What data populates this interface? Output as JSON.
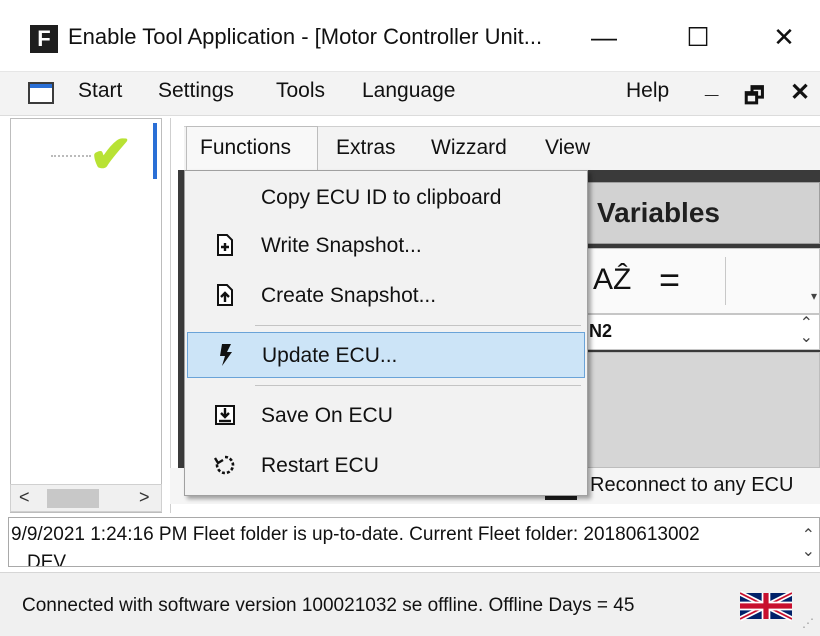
{
  "window": {
    "app_icon_letter": "F",
    "title": "Enable Tool Application - [Motor Controller Unit...",
    "minimize_glyph": "—",
    "maximize_glyph": "☐",
    "close_glyph": "✕"
  },
  "menubar": {
    "items": [
      "Start",
      "Settings",
      "Tools",
      "Language"
    ],
    "help": "Help",
    "mdi_minimize": "_",
    "mdi_restore": "🗗",
    "mdi_close": "✕"
  },
  "tree": {
    "check_glyph": "✔",
    "scroll_left": "<",
    "scroll_right": ">"
  },
  "tabs": [
    "Functions",
    "Extras",
    "Wizzard",
    "View"
  ],
  "dropdown": {
    "items": [
      {
        "label": "Copy ECU ID to clipboard",
        "icon": "none"
      },
      {
        "label": "Write Snapshot...",
        "icon": "file-plus-icon"
      },
      {
        "label": "Create Snapshot...",
        "icon": "file-upload-icon"
      },
      {
        "label": "Update ECU...",
        "icon": "lightning-icon"
      },
      {
        "label": "Save On ECU",
        "icon": "save-download-icon"
      },
      {
        "label": "Restart ECU",
        "icon": "restart-icon"
      }
    ]
  },
  "variables_panel": {
    "title": "Variables",
    "sort_glyph": "AẐ",
    "equals_glyph": "=",
    "row_value": "N2"
  },
  "reconnect": {
    "label": "Reconnect to any ECU"
  },
  "bottom_glyph": "⋮",
  "log": {
    "line1": "9/9/2021 1:24:16 PM Fleet folder is up-to-date. Current Fleet folder: 20180613002",
    "line2": "DEV"
  },
  "status": {
    "text": "Connected with software version 100021032 se offline. Offline Days = 45",
    "language_icon": "uk-flag-icon"
  }
}
